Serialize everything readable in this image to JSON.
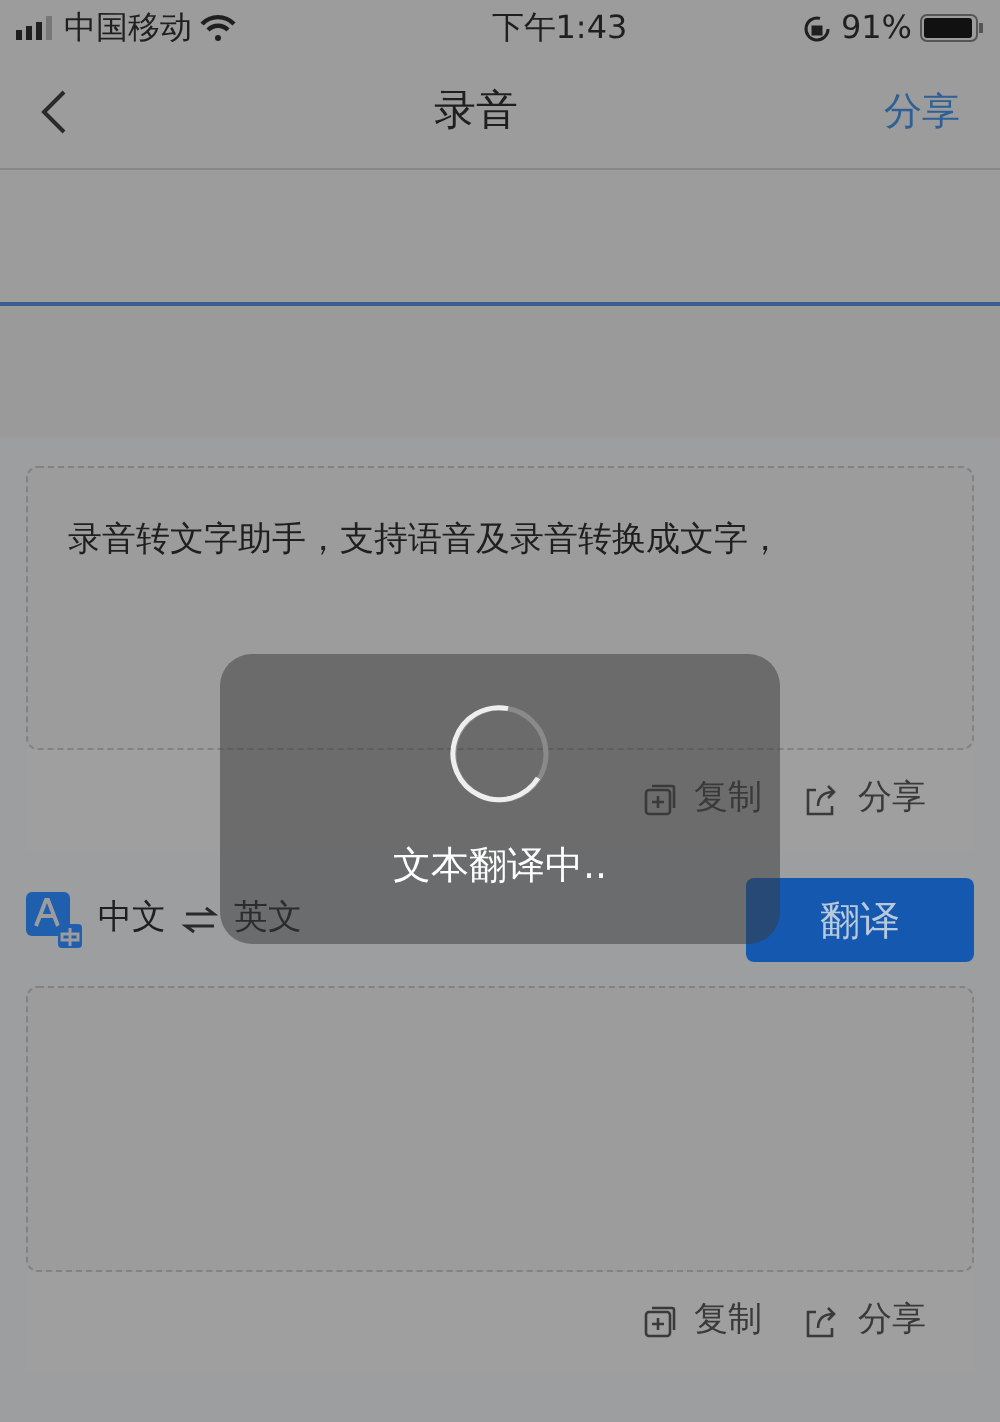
{
  "status_bar": {
    "carrier": "中国移动",
    "time": "下午1:43",
    "battery": "91%"
  },
  "nav": {
    "title": "录音",
    "action": "分享"
  },
  "source_card": {
    "text": "录音转文字助手，支持语音及录音转换成文字，",
    "actions": [
      {
        "kind": "copy",
        "label": "复制"
      },
      {
        "kind": "share",
        "label": "分享"
      }
    ]
  },
  "languages": {
    "source": "中文",
    "target": "英文"
  },
  "translate_button": "翻译",
  "result_card": {
    "actions": [
      {
        "kind": "copy",
        "label": "复制"
      },
      {
        "kind": "share",
        "label": "分享"
      }
    ]
  },
  "loading": {
    "message": "文本翻译中.."
  }
}
